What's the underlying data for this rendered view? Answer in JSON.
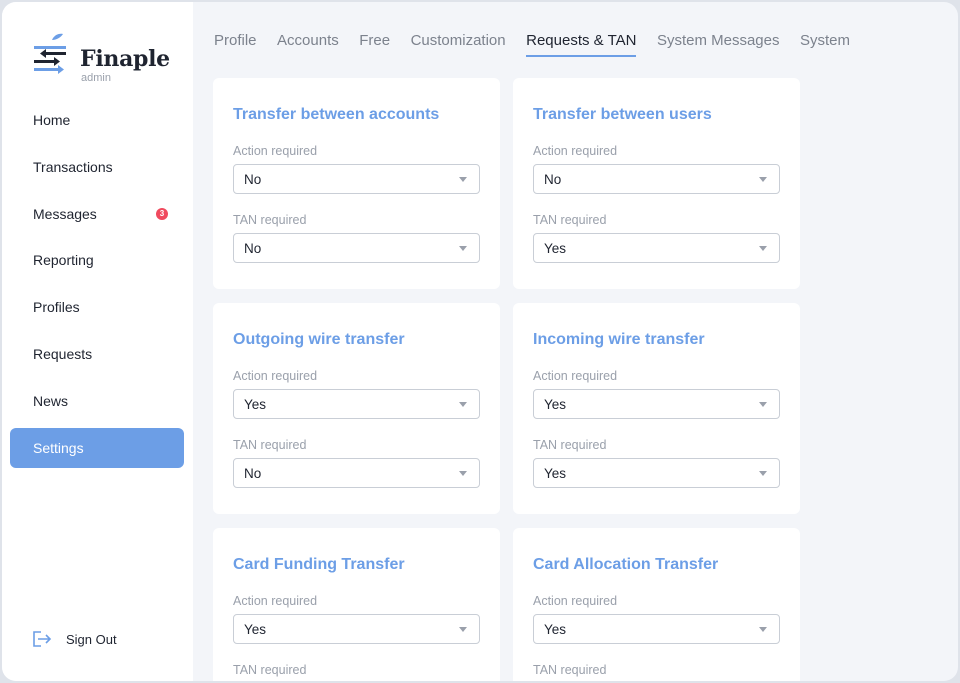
{
  "brand": {
    "name": "Finaple",
    "sub": "admin"
  },
  "sidebar": {
    "items": [
      {
        "label": "Home"
      },
      {
        "label": "Transactions"
      },
      {
        "label": "Messages",
        "badge": "3"
      },
      {
        "label": "Reporting"
      },
      {
        "label": "Profiles"
      },
      {
        "label": "Requests"
      },
      {
        "label": "News"
      },
      {
        "label": "Settings",
        "active": true
      }
    ],
    "signout": "Sign Out"
  },
  "tabs": [
    {
      "label": "Profile"
    },
    {
      "label": "Accounts"
    },
    {
      "label": "Free"
    },
    {
      "label": "Customization"
    },
    {
      "label": "Requests & TAN",
      "active": true
    },
    {
      "label": "System Messages"
    },
    {
      "label": "System"
    }
  ],
  "cards": [
    {
      "title": "Transfer between accounts",
      "action_label": "Action required",
      "action_value": "No",
      "tan_label": "TAN required",
      "tan_value": "No"
    },
    {
      "title": "Transfer between users",
      "action_label": "Action required",
      "action_value": "No",
      "tan_label": "TAN required",
      "tan_value": "Yes"
    },
    {
      "title": "Outgoing wire transfer",
      "action_label": "Action required",
      "action_value": "Yes",
      "tan_label": "TAN required",
      "tan_value": "No"
    },
    {
      "title": "Incoming wire transfer",
      "action_label": "Action required",
      "action_value": "Yes",
      "tan_label": "TAN required",
      "tan_value": "Yes"
    },
    {
      "title": "Card Funding Transfer",
      "action_label": "Action required",
      "action_value": "Yes",
      "tan_label": "TAN required"
    },
    {
      "title": "Card Allocation Transfer",
      "action_label": "Action required",
      "action_value": "Yes",
      "tan_label": "TAN required"
    }
  ],
  "colors": {
    "accent": "#6c9ee6",
    "badge": "#f04a5e",
    "background": "#f3f5f9"
  }
}
